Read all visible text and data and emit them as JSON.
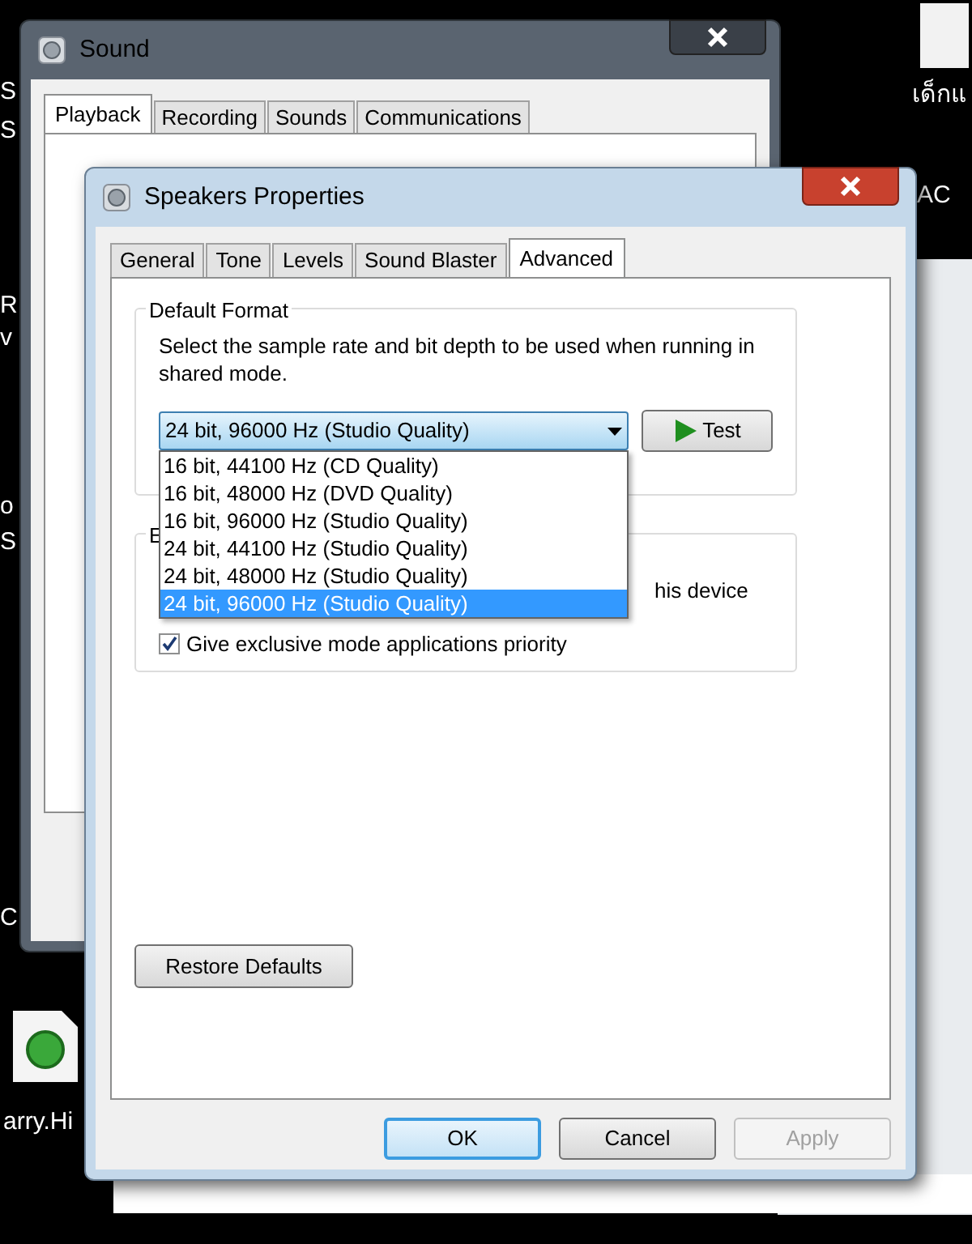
{
  "desktop": {
    "labels": [
      "S",
      "S",
      "R",
      "v",
      "o",
      "S",
      "C",
      "arry.Hi",
      "เด็กแ",
      "AC"
    ]
  },
  "sound_window": {
    "title": "Sound",
    "tabs": [
      {
        "label": "Playback",
        "selected": true
      },
      {
        "label": "Recording",
        "selected": false
      },
      {
        "label": "Sounds",
        "selected": false
      },
      {
        "label": "Communications",
        "selected": false
      }
    ]
  },
  "properties_window": {
    "title": "Speakers Properties",
    "tabs": [
      {
        "label": "General",
        "selected": false
      },
      {
        "label": "Tone",
        "selected": false
      },
      {
        "label": "Levels",
        "selected": false
      },
      {
        "label": "Sound Blaster",
        "selected": false
      },
      {
        "label": "Advanced",
        "selected": true
      }
    ],
    "default_format": {
      "title": "Default Format",
      "description": "Select the sample rate and bit depth to be used when running in shared mode.",
      "value": "24 bit, 96000 Hz (Studio Quality)",
      "expanded": true,
      "test_button": "Test",
      "options": [
        {
          "label": "16 bit, 44100 Hz (CD Quality)",
          "selected": false
        },
        {
          "label": "16 bit, 48000 Hz (DVD Quality)",
          "selected": false
        },
        {
          "label": "16 bit, 96000 Hz (Studio Quality)",
          "selected": false
        },
        {
          "label": "24 bit, 44100 Hz (Studio Quality)",
          "selected": false
        },
        {
          "label": "24 bit, 48000 Hz (Studio Quality)",
          "selected": false
        },
        {
          "label": "24 bit, 96000 Hz (Studio Quality)",
          "selected": true
        }
      ]
    },
    "exclusive_mode": {
      "title": "E",
      "first_option_fragment": "his device",
      "priority": {
        "label": "Give exclusive mode applications priority",
        "checked": true
      }
    },
    "restore_button": "Restore Defaults",
    "buttons": [
      {
        "label": "OK",
        "default": true,
        "disabled": false
      },
      {
        "label": "Cancel",
        "default": false,
        "disabled": false
      },
      {
        "label": "Apply",
        "default": false,
        "disabled": true
      }
    ]
  }
}
